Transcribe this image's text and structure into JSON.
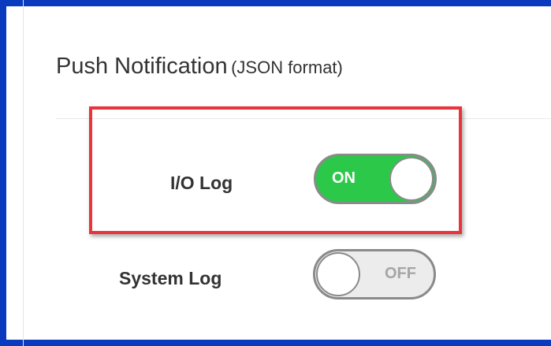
{
  "section": {
    "title": "Push Notification",
    "subtitle": "(JSON format)"
  },
  "settings": [
    {
      "label": "I/O Log",
      "state": "ON",
      "enabled": true
    },
    {
      "label": "System Log",
      "state": "OFF",
      "enabled": false
    }
  ],
  "colors": {
    "frame_border": "#0a3bbf",
    "highlight_border": "#e8353b",
    "toggle_on": "#2cc84a",
    "toggle_off": "#ececec"
  }
}
